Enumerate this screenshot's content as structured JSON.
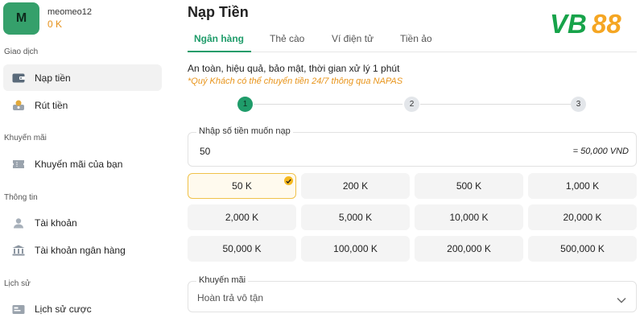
{
  "user": {
    "avatar_letter": "M",
    "name": "meomeo12",
    "balance": "0 K"
  },
  "sidebar": {
    "sections": [
      {
        "title": "Giao dịch",
        "items": [
          {
            "label": "Nạp tiền",
            "icon": "wallet-icon",
            "active": true
          },
          {
            "label": "Rút tiền",
            "icon": "cash-out-icon"
          }
        ]
      },
      {
        "title": "Khuyến mãi",
        "items": [
          {
            "label": "Khuyến mãi của bạn",
            "icon": "ticket-icon"
          }
        ]
      },
      {
        "title": "Thông tin",
        "items": [
          {
            "label": "Tài khoản",
            "icon": "user-icon"
          },
          {
            "label": "Tài khoản ngân hàng",
            "icon": "bank-icon"
          }
        ]
      },
      {
        "title": "Lịch sử",
        "items": [
          {
            "label": "Lịch sử cược",
            "icon": "history-icon"
          }
        ]
      }
    ]
  },
  "main": {
    "title": "Nạp Tiền",
    "logo_text": "VB88",
    "tabs": [
      {
        "label": "Ngân hàng",
        "active": true
      },
      {
        "label": "Thẻ cào"
      },
      {
        "label": "Ví điện tử"
      },
      {
        "label": "Tiền ảo"
      }
    ],
    "info_line1": "An toàn, hiệu quả, bảo mật, thời gian xử lý 1 phút",
    "info_line2": "*Quý Khách có thể chuyển tiền 24/7 thông qua NAPAS",
    "steps": [
      "1",
      "2",
      "3"
    ],
    "current_step": 1,
    "amount": {
      "label": "Nhập số tiền muốn nạp",
      "value": "50",
      "converted": "= 50,000 VND"
    },
    "amount_options": [
      "50 K",
      "200 K",
      "500 K",
      "1,000 K",
      "2,000 K",
      "5,000 K",
      "10,000 K",
      "20,000 K",
      "50,000 K",
      "100,000 K",
      "200,000 K",
      "500,000 K"
    ],
    "selected_option": "50 K",
    "promotion": {
      "label": "Khuyến mãi",
      "value": "Hoàn trả vô tận"
    }
  },
  "colors": {
    "accent": "#1f9c6a",
    "balance": "#e59018",
    "note": "#e8941a",
    "selected_border": "#f0c24a",
    "logo_green": "#17a34a",
    "logo_gold": "#f5a623"
  }
}
